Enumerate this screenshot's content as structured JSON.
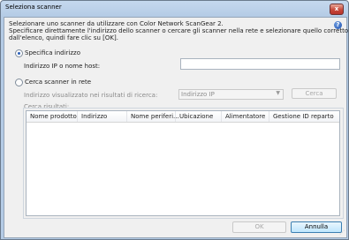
{
  "window": {
    "title": "Seleziona scanner",
    "close_glyph": "x"
  },
  "intro": {
    "line1": "Selezionare uno scanner da utilizzare con Color Network ScanGear 2.",
    "line2": "Specificare direttamente l'indirizzo dello scanner o cercare gli scanner nella rete e selezionare quello corretto",
    "line3": "dall'elenco, quindi fare clic su [OK]."
  },
  "help_icon": "help-icon",
  "specify_address": {
    "radio_label": "Specifica indirizzo",
    "checked": true,
    "field_label": "Indirizzo IP o nome host:",
    "field_value": ""
  },
  "search_network": {
    "radio_label": "Cerca scanner in rete",
    "checked": false,
    "address_label": "Indirizzo visualizzato nei risultati di ricerca:",
    "address_select_value": "Indirizzo IP",
    "search_button": "Cerca",
    "results_label": "Cerca risultati:",
    "columns": [
      "Nome prodotto",
      "Indirizzo",
      "Nome periferi...",
      "Ubicazione",
      "Alimentatore",
      "Gestione ID reparto"
    ],
    "rows": []
  },
  "footer": {
    "ok_button": "OK",
    "cancel_button": "Annulla"
  },
  "colors": {
    "titlebar": "#b4cbe5",
    "dialog_bg": "#f0f0f0",
    "help_icon": "#1f4fae",
    "close_button": "#c8483a"
  }
}
